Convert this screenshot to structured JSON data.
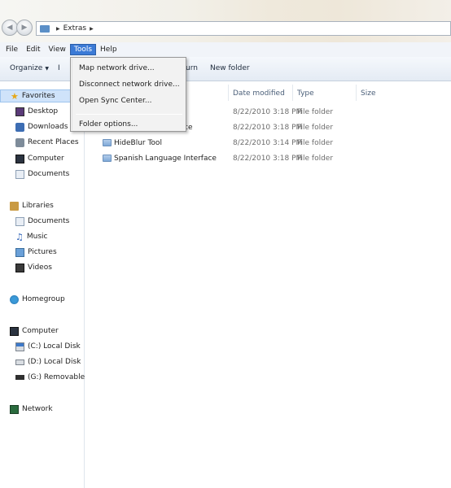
{
  "window": {
    "address": "Extras"
  },
  "menu": {
    "items": [
      "File",
      "Edit",
      "View",
      "Tools",
      "Help"
    ],
    "active": "Tools"
  },
  "toolbar": {
    "organize_label": "Organize",
    "partial_left": "I",
    "partial_right": "urn",
    "new_folder_label": "New folder"
  },
  "tools_menu": {
    "items": [
      "Map network drive...",
      "Disconnect network drive...",
      "Open Sync Center...",
      "Folder options..."
    ]
  },
  "sidebar": {
    "favorites": {
      "label": "Favorites",
      "items": [
        "Desktop",
        "Downloads",
        "Recent Places",
        "Computer",
        "Documents"
      ]
    },
    "libraries": {
      "label": "Libraries",
      "items": [
        "Documents",
        "Music",
        "Pictures",
        "Videos"
      ]
    },
    "homegroup": {
      "label": "Homegroup"
    },
    "computer": {
      "label": "Computer",
      "items": [
        "(C:) Local Disk",
        "(D:) Local Disk",
        "(G:) Removable Disk"
      ]
    },
    "network": {
      "label": "Network"
    }
  },
  "columns": {
    "date_modified": "Date modified",
    "type": "Type",
    "size": "Size"
  },
  "files": [
    {
      "name": "",
      "date": "8/22/2010 3:18 PM",
      "type": "File folder"
    },
    {
      "name": "ce",
      "date": "8/22/2010 3:18 PM",
      "type": "File folder"
    },
    {
      "name": "HideBlur Tool",
      "date": "8/22/2010 3:14 PM",
      "type": "File folder"
    },
    {
      "name": "Spanish Language Interface",
      "date": "8/22/2010 3:18 PM",
      "type": "File folder"
    }
  ],
  "colors": {
    "menu_active": "#3b7ad6",
    "sidebar_selected": "#cfe3fa",
    "folder": "#7fa9d8"
  }
}
